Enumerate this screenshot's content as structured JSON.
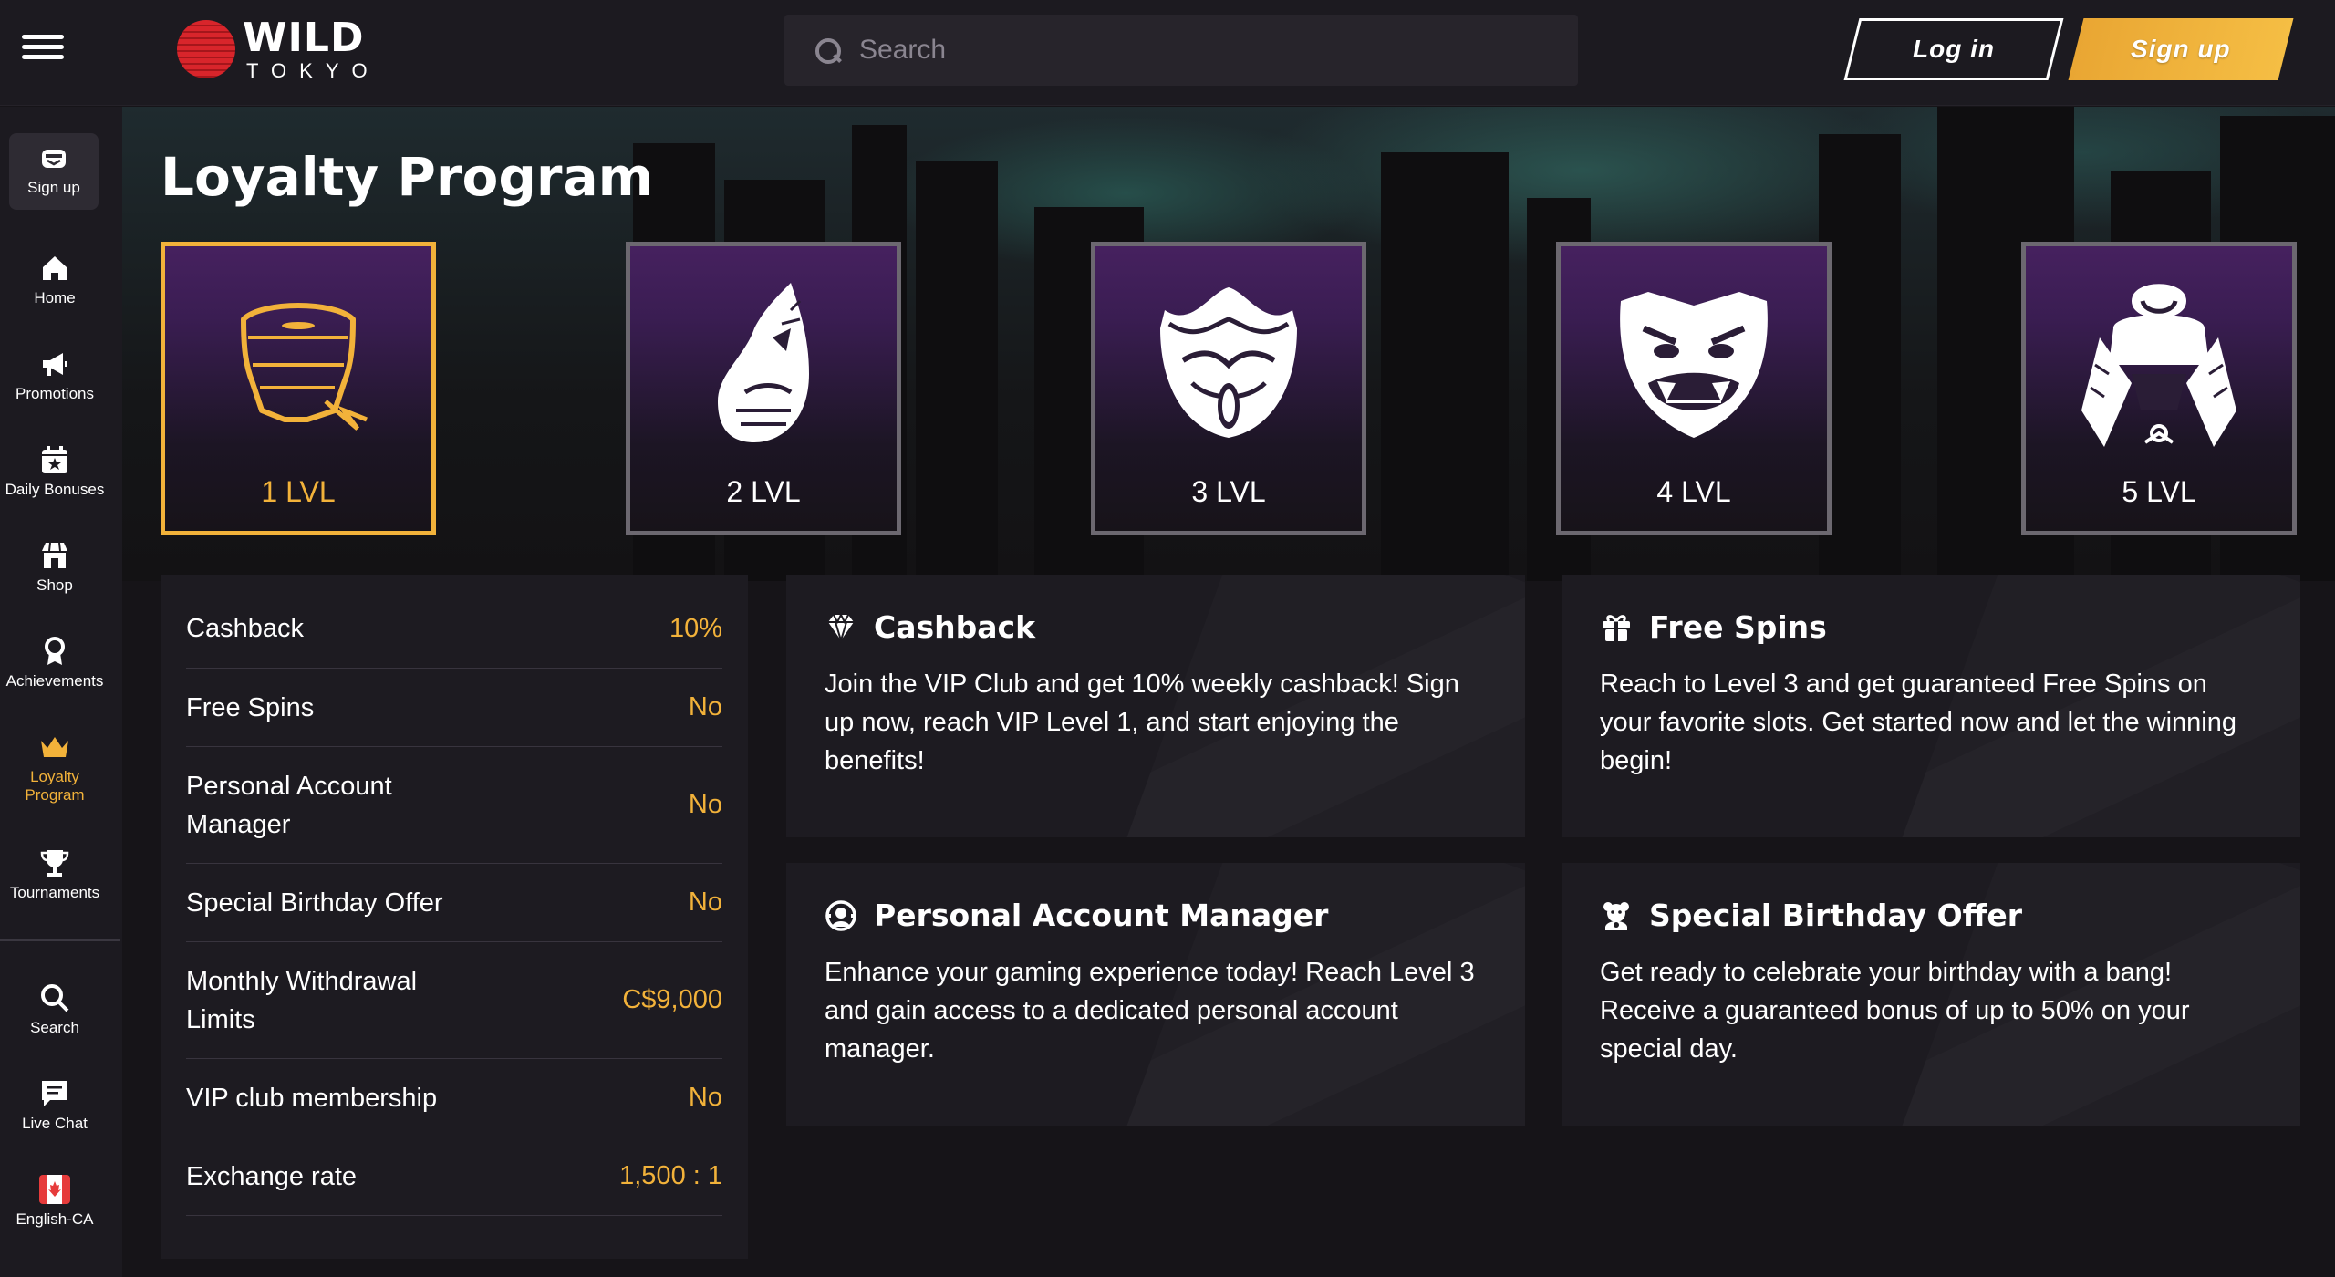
{
  "header": {
    "logo_main": "WILD",
    "logo_sub": "TOKYO",
    "search_placeholder": "Search",
    "login_label": "Log in",
    "signup_label": "Sign up"
  },
  "sidebar": {
    "items": [
      {
        "label": "Sign up",
        "icon": "gift-box-icon"
      },
      {
        "label": "Home",
        "icon": "home-icon"
      },
      {
        "label": "Promotions",
        "icon": "megaphone-icon"
      },
      {
        "label": "Daily Bonuses",
        "icon": "calendar-star-icon"
      },
      {
        "label": "Shop",
        "icon": "shop-icon"
      },
      {
        "label": "Achievements",
        "icon": "award-icon"
      },
      {
        "label": "Loyalty Program",
        "icon": "crown-icon"
      },
      {
        "label": "Tournaments",
        "icon": "trophy-icon"
      },
      {
        "label": "Search",
        "icon": "search-icon"
      },
      {
        "label": "Live Chat",
        "icon": "chat-icon"
      },
      {
        "label": "English-CA",
        "icon": "canada-flag-icon"
      }
    ]
  },
  "page": {
    "title": "Loyalty Program"
  },
  "levels": [
    {
      "label": "1 LVL",
      "selected": true
    },
    {
      "label": "2 LVL",
      "selected": false
    },
    {
      "label": "3 LVL",
      "selected": false
    },
    {
      "label": "4 LVL",
      "selected": false
    },
    {
      "label": "5 LVL",
      "selected": false
    }
  ],
  "benefits": [
    {
      "name": "Cashback",
      "value": "10%"
    },
    {
      "name": "Free Spins",
      "value": "No"
    },
    {
      "name": "Personal Account Manager",
      "value": "No"
    },
    {
      "name": "Special Birthday Offer",
      "value": "No"
    },
    {
      "name": "Monthly Withdrawal Limits",
      "value": "C$9,000"
    },
    {
      "name": "VIP club membership",
      "value": "No"
    },
    {
      "name": "Exchange rate",
      "value": "1,500 : 1"
    }
  ],
  "features": [
    {
      "title": "Cashback",
      "icon": "diamond-icon",
      "text": "Join the VIP Club and get 10% weekly cashback! Sign up now, reach VIP Level 1, and start enjoying the benefits!"
    },
    {
      "title": "Free Spins",
      "icon": "gift-icon",
      "text": "Reach to Level 3 and get guaranteed Free Spins on your favorite slots. Get started now and let the winning begin!"
    },
    {
      "title": "Personal Account Manager",
      "icon": "manager-icon",
      "text": "Enhance your gaming experience today! Reach Level 3 and gain access to a dedicated personal account manager."
    },
    {
      "title": "Special Birthday Offer",
      "icon": "birthday-bear-icon",
      "text": "Get ready to celebrate your birthday with a bang! Receive a guaranteed bonus of up to 50% on your special day."
    }
  ],
  "colors": {
    "accent": "#f2b23a",
    "background": "#161418",
    "panel": "#1d1b21",
    "card_purple": "#46215f"
  }
}
